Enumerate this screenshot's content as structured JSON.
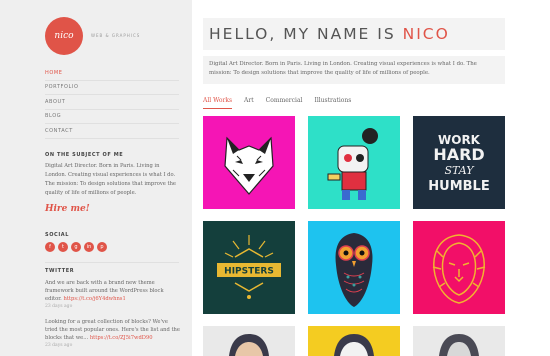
{
  "brand": {
    "logo_text": "nico",
    "tagline": "WEB & GRAPHICS"
  },
  "nav": [
    "HOME",
    "PORTFOLIO",
    "ABOUT",
    "BLOG",
    "CONTACT"
  ],
  "about": {
    "title": "ON THE SUBJECT OF ME",
    "text": "Digital Art Director. Born in Paris. Living in London. Creating visual experiences is what I do. The mission: To design solutions that improve the quality of life of millions of people.",
    "hire_label": "Hire me!"
  },
  "social": {
    "title": "SOCIAL",
    "icons": [
      "f",
      "t",
      "g",
      "in",
      "p"
    ]
  },
  "twitter": {
    "title": "TWITTER",
    "tweets": [
      {
        "text": "And we are back with a brand new theme framework built around the WordPress block editor.",
        "link": "https://t.co/j6Y4dwhns1",
        "time": "23 days ago"
      },
      {
        "text": "Looking for a great collection of blocks? We've tried the most popular ones. Here's the list and the blocks that we...",
        "link": "https://t.co/ZJ5i7wdD90",
        "time": "23 days ago"
      }
    ]
  },
  "header": {
    "title_prefix": "HELLO, MY NAME IS ",
    "title_name": "NICO"
  },
  "intro": "Digital Art Director. Born in Paris. Living in London. Creating visual experiences is what I do. The mission: To design solutions that improve the quality of life of millions of people.",
  "filters": [
    "All Works",
    "Art",
    "Commercial",
    "Illustrations"
  ],
  "portfolio": [
    {
      "subject": "wolf",
      "color": "#f515b5"
    },
    {
      "subject": "robot-character",
      "color": "#2ee0c8"
    },
    {
      "subject": "typography-poster",
      "color": "#1e2e3e",
      "lines": [
        "WORK",
        "HARD",
        "STAY",
        "HUMBLE"
      ]
    },
    {
      "subject": "hipsters-badge",
      "color": "#143f3c",
      "text": "HIPSTERS"
    },
    {
      "subject": "owl",
      "color": "#1ec3ef"
    },
    {
      "subject": "lion",
      "color": "#f20f68"
    },
    {
      "subject": "portrait",
      "color": "#e9e9e9"
    },
    {
      "subject": "portrait",
      "color": "#f4cc21"
    },
    {
      "subject": "portrait",
      "color": "#e9e9e9"
    }
  ]
}
